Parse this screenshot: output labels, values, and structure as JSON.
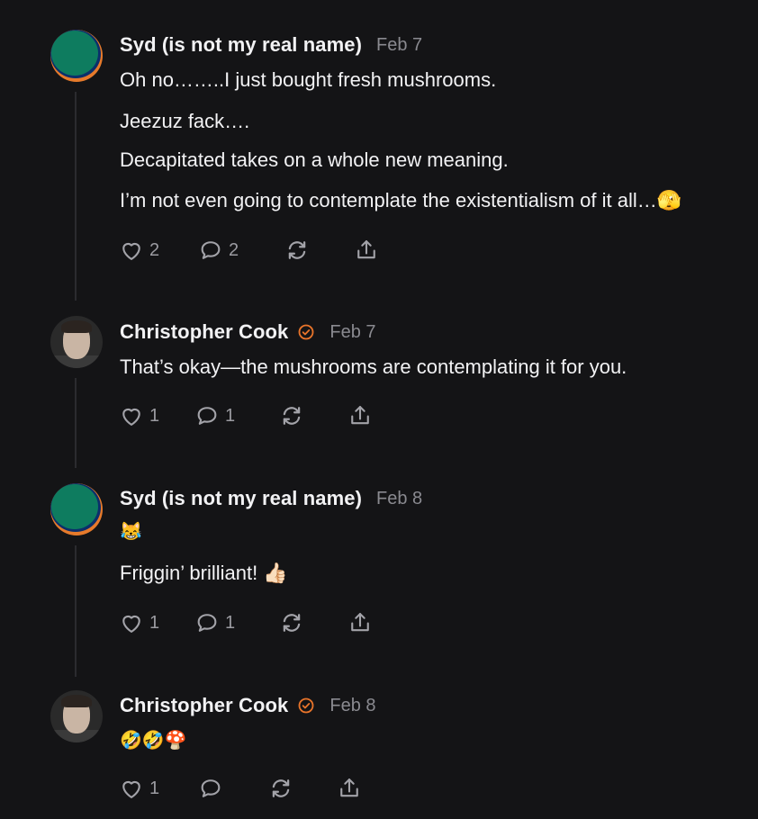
{
  "colors": {
    "background": "#141416",
    "text": "#f2f2f4",
    "muted": "#8a8a90",
    "verified": "#e8742a",
    "thread": "#2b2b2f"
  },
  "comments": [
    {
      "author": "Syd (is not my real name)",
      "date": "Feb 7",
      "verified": false,
      "paragraphs": [
        "Oh no……..I just bought fresh mushrooms.",
        "Jeezuz fack….",
        "Decapitated takes on a whole new meaning.",
        "I’m not even going to contemplate the existentialism of it all…🫣"
      ],
      "likes": "2",
      "replies": "2"
    },
    {
      "author": "Christopher Cook",
      "date": "Feb 7",
      "verified": true,
      "paragraphs": [
        "That’s okay—the mushrooms are contemplating it for you."
      ],
      "likes": "1",
      "replies": "1"
    },
    {
      "author": "Syd (is not my real name)",
      "date": "Feb 8",
      "verified": false,
      "paragraphs": [
        "😹",
        "Friggin’ brilliant! 👍🏻"
      ],
      "likes": "1",
      "replies": "1"
    },
    {
      "author": "Christopher Cook",
      "date": "Feb 8",
      "verified": true,
      "paragraphs": [
        "🤣🤣🍄"
      ],
      "likes": "1",
      "replies": ""
    }
  ],
  "icons": {
    "like": "heart-icon",
    "reply": "speech-bubble-icon",
    "restack": "restack-icon",
    "share": "share-icon",
    "verified": "verified-check-icon"
  }
}
